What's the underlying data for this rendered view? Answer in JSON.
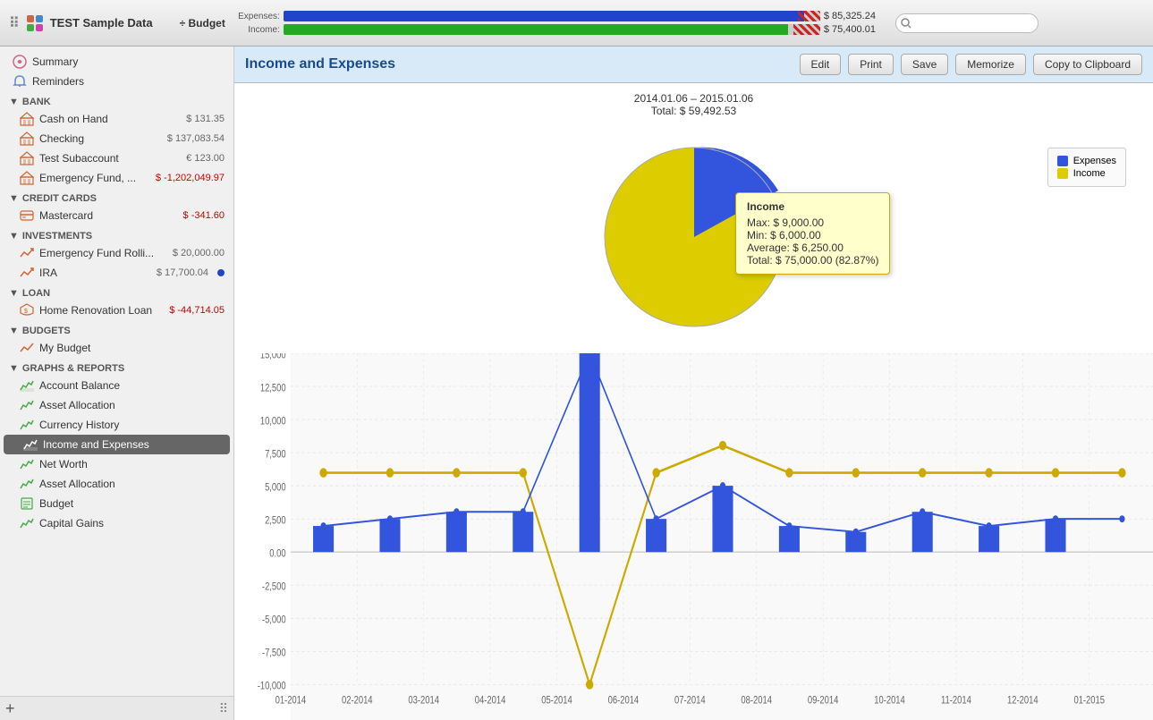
{
  "app": {
    "title": "TEST Sample Data",
    "drag_handle": "⠿"
  },
  "toolbar": {
    "budget_label": "÷ Budget",
    "expenses_label": "Expenses:",
    "expenses_value": "$ 85,325.24",
    "income_label": "Income:",
    "income_value": "$ 75,400.01",
    "search_placeholder": ""
  },
  "sidebar": {
    "summary_label": "Summary",
    "reminders_label": "Reminders",
    "sections": [
      {
        "name": "BANK",
        "items": [
          {
            "label": "Cash on Hand",
            "value": "$ 131.35",
            "neg": false
          },
          {
            "label": "Checking",
            "value": "$ 137,083.54",
            "neg": false
          },
          {
            "label": "Test Subaccount",
            "value": "€ 123.00",
            "neg": false
          },
          {
            "label": "Emergency Fund, ...",
            "value": "$ -1,202,049.97",
            "neg": true
          }
        ]
      },
      {
        "name": "CREDIT CARDS",
        "items": [
          {
            "label": "Mastercard",
            "value": "$ -341.60",
            "neg": true
          }
        ]
      },
      {
        "name": "INVESTMENTS",
        "items": [
          {
            "label": "Emergency Fund Rolli...",
            "value": "$ 20,000.00",
            "neg": false
          },
          {
            "label": "IRA",
            "value": "$ 17,700.04",
            "neg": false,
            "dot": true
          }
        ]
      },
      {
        "name": "LOAN",
        "items": [
          {
            "label": "Home Renovation Loan",
            "value": "$ -44,714.05",
            "neg": true
          }
        ]
      },
      {
        "name": "BUDGETS",
        "items": [
          {
            "label": "My Budget",
            "value": "",
            "neg": false
          }
        ]
      },
      {
        "name": "GRAPHS & REPORTS",
        "items": [
          {
            "label": "Account Balance",
            "value": "",
            "neg": false
          },
          {
            "label": "Asset Allocation",
            "value": "",
            "neg": false
          },
          {
            "label": "Currency History",
            "value": "",
            "neg": false
          },
          {
            "label": "Income and Expenses",
            "value": "",
            "neg": false,
            "active": true
          },
          {
            "label": "Net Worth",
            "value": "",
            "neg": false
          },
          {
            "label": "Asset Allocation",
            "value": "",
            "neg": false
          },
          {
            "label": "Budget",
            "value": "",
            "neg": false
          },
          {
            "label": "Capital Gains",
            "value": "",
            "neg": false
          }
        ]
      }
    ]
  },
  "report": {
    "title": "Income and Expenses",
    "date_range": "2014.01.06 – 2015.01.06",
    "total": "Total: $ 59,492.53",
    "buttons": [
      "Edit",
      "Print",
      "Save",
      "Memorize",
      "Copy to Clipboard"
    ]
  },
  "legend": {
    "items": [
      {
        "label": "Expenses",
        "color": "#3355dd"
      },
      {
        "label": "Income",
        "color": "#ddcc00"
      }
    ]
  },
  "tooltip": {
    "title": "Income",
    "max": "Max: $ 9,000.00",
    "min": "Min: $ 6,000.00",
    "average": "Average: $ 6,250.00",
    "total": "Total: $ 75,000.00 (82.87%)"
  },
  "chart": {
    "y_labels": [
      "15,000.00",
      "12,500.00",
      "10,000.00",
      "7,500.00",
      "5,000.00",
      "2,500.00",
      "0.00",
      "-2,500.00",
      "-5,000.00",
      "-7,500.00",
      "-10,000.00"
    ],
    "x_labels": [
      "01-2014",
      "02-2014",
      "03-2014",
      "04-2014",
      "05-2014",
      "06-2014",
      "07-2014",
      "08-2014",
      "09-2014",
      "10-2014",
      "11-2014",
      "12-2014",
      "01-2015"
    ]
  }
}
